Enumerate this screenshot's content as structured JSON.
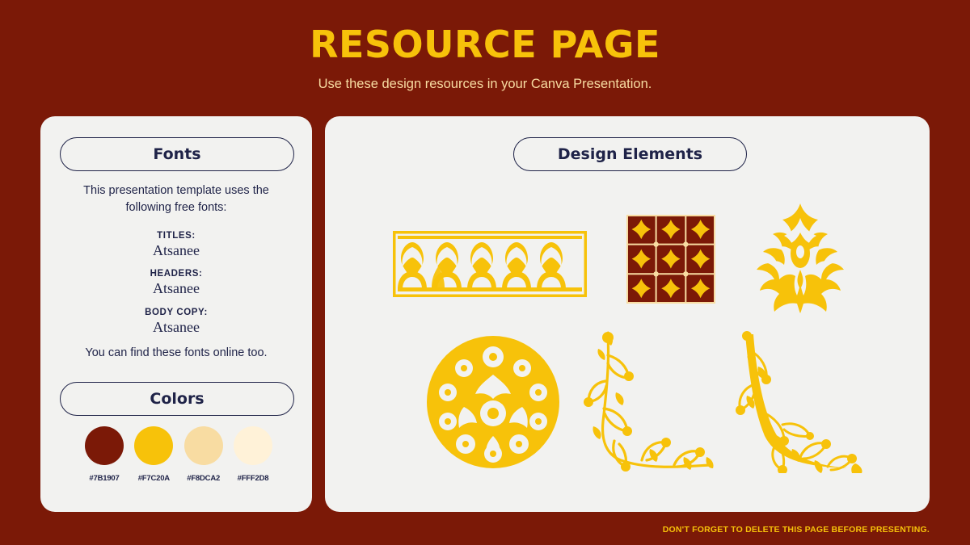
{
  "slide": {
    "background_color": "#7B1907",
    "title": "RESOURCE PAGE",
    "subtitle": "Use these design resources in your Canva Presentation.",
    "footer_note": "DON'T FORGET TO DELETE THIS PAGE BEFORE PRESENTING."
  },
  "fonts_card": {
    "heading": "Fonts",
    "intro": "This presentation template uses the following free fonts:",
    "entries": [
      {
        "label": "TITLES:",
        "value": "Atsanee"
      },
      {
        "label": "HEADERS:",
        "value": "Atsanee"
      },
      {
        "label": "BODY COPY:",
        "value": "Atsanee"
      }
    ],
    "note": "You can find these fonts online too."
  },
  "colors_card": {
    "heading": "Colors",
    "swatches": [
      {
        "hex": "#7B1907",
        "code": "#7B1907"
      },
      {
        "hex": "#F7C20A",
        "code": "#F7C20A"
      },
      {
        "hex": "#F8DCA2",
        "code": "#F8DCA2"
      },
      {
        "hex": "#FFF2D8",
        "code": "#FFF2D8"
      }
    ]
  },
  "design_card": {
    "heading": "Design Elements",
    "elements": [
      {
        "name": "ornamental-border-strip",
        "color": "#F7C20A"
      },
      {
        "name": "patterned-tile-square",
        "color": "#7B1907"
      },
      {
        "name": "damask-ornament",
        "color": "#F7C20A"
      },
      {
        "name": "floral-circle-medallion",
        "color": "#F7C20A"
      },
      {
        "name": "floral-corner-flourish-left",
        "color": "#F7C20A"
      },
      {
        "name": "floral-corner-flourish-right",
        "color": "#F7C20A"
      }
    ]
  }
}
